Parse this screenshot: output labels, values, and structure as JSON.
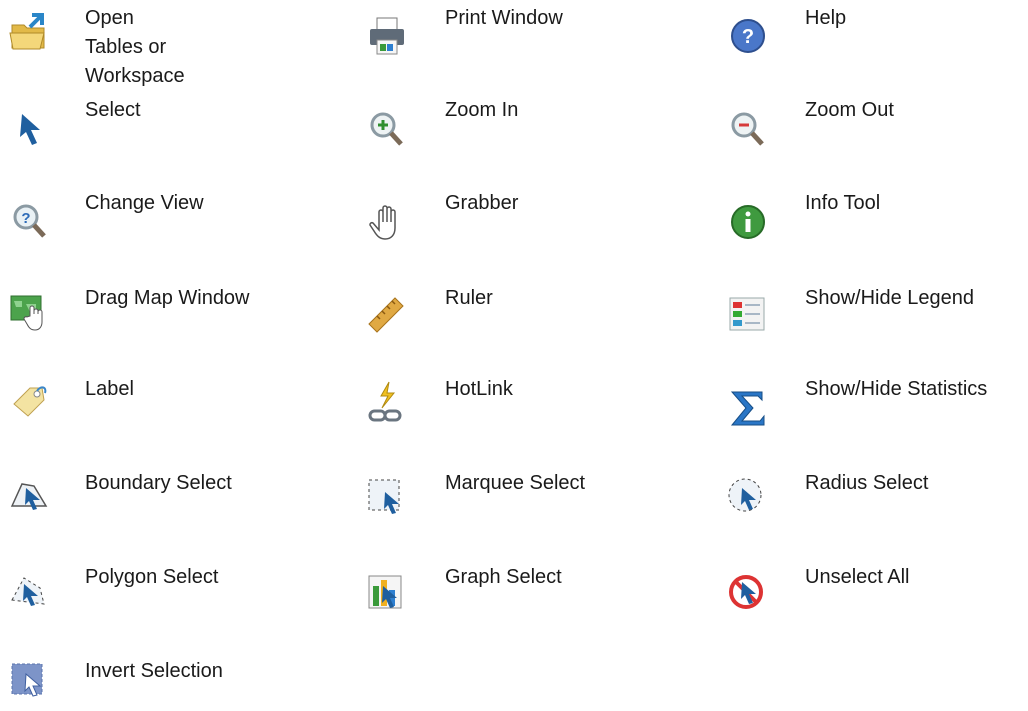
{
  "items": [
    {
      "label": "Open Tables or\nWorkspace",
      "icon": "open-folder-icon"
    },
    {
      "label": "Print Window",
      "icon": "printer-icon"
    },
    {
      "label": "Help",
      "icon": "help-icon"
    },
    {
      "label": "Select",
      "icon": "arrow-cursor-icon"
    },
    {
      "label": "Zoom In",
      "icon": "zoom-in-icon"
    },
    {
      "label": "Zoom Out",
      "icon": "zoom-out-icon"
    },
    {
      "label": "Change View",
      "icon": "change-view-icon"
    },
    {
      "label": "Grabber",
      "icon": "hand-icon"
    },
    {
      "label": "Info Tool",
      "icon": "info-icon"
    },
    {
      "label": "Drag Map Window",
      "icon": "drag-map-icon"
    },
    {
      "label": "Ruler",
      "icon": "ruler-icon"
    },
    {
      "label": "Show/Hide Legend",
      "icon": "legend-icon"
    },
    {
      "label": "Label",
      "icon": "tag-icon"
    },
    {
      "label": "HotLink",
      "icon": "hotlink-icon"
    },
    {
      "label": "Show/Hide Statistics",
      "icon": "sigma-icon"
    },
    {
      "label": "Boundary Select",
      "icon": "boundary-select-icon"
    },
    {
      "label": "Marquee Select",
      "icon": "marquee-select-icon"
    },
    {
      "label": "Radius Select",
      "icon": "radius-select-icon"
    },
    {
      "label": "Polygon Select",
      "icon": "polygon-select-icon"
    },
    {
      "label": "Graph Select",
      "icon": "graph-select-icon"
    },
    {
      "label": "Unselect All",
      "icon": "unselect-all-icon"
    },
    {
      "label": "Invert Selection",
      "icon": "invert-selection-icon"
    }
  ]
}
